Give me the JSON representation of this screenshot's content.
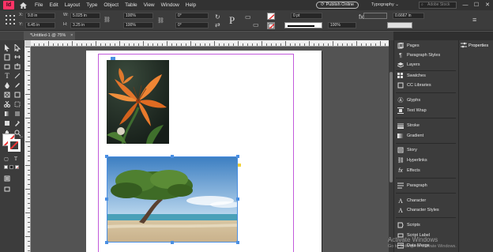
{
  "app": {
    "logo": "Id"
  },
  "menu": [
    "File",
    "Edit",
    "Layout",
    "Type",
    "Object",
    "Table",
    "View",
    "Window",
    "Help"
  ],
  "header": {
    "publish_label": "Publish Online",
    "workspace_label": "Typography",
    "search_placeholder": "Adobe Stock"
  },
  "window_controls": {
    "minimize": "—",
    "maximize": "☐",
    "close": "✕"
  },
  "control_panel": {
    "x_label": "X:",
    "x_value": "9.8 in",
    "y_label": "Y:",
    "y_value": "6.45 in",
    "w_label": "W:",
    "w_value": "5.025 in",
    "h_label": "H:",
    "h_value": "3.25 in",
    "scale_x": "100%",
    "scale_y": "100%",
    "rotate": "0°",
    "shear": "0°",
    "stroke_weight": "0 pt",
    "opacity": "100%",
    "width_value": "0.6667 in"
  },
  "document_tab": {
    "title": "*Untitled-1 @ 75%",
    "close": "×"
  },
  "panels": {
    "items": [
      {
        "label": "Pages",
        "icon": "pages-icon"
      },
      {
        "label": "Paragraph Styles",
        "icon": "paragraph-styles-icon"
      },
      {
        "label": "Layers",
        "icon": "layers-icon"
      },
      {
        "label": "Swatches",
        "icon": "swatches-icon"
      },
      {
        "label": "CC Libraries",
        "icon": "cc-libraries-icon"
      },
      {
        "label": "Glyphs",
        "icon": "glyphs-icon"
      },
      {
        "label": "Text Wrap",
        "icon": "text-wrap-icon"
      },
      {
        "label": "Stroke",
        "icon": "stroke-icon"
      },
      {
        "label": "Gradient",
        "icon": "gradient-icon"
      },
      {
        "label": "Story",
        "icon": "story-icon"
      },
      {
        "label": "Hyperlinks",
        "icon": "hyperlinks-icon"
      },
      {
        "label": "Effects",
        "icon": "effects-icon"
      },
      {
        "label": "Paragraph",
        "icon": "paragraph-icon"
      },
      {
        "label": "Character",
        "icon": "character-icon"
      },
      {
        "label": "Character Styles",
        "icon": "character-styles-icon"
      },
      {
        "label": "Scripts",
        "icon": "scripts-icon"
      },
      {
        "label": "Script Label",
        "icon": "script-label-icon"
      },
      {
        "label": "Data Merge",
        "icon": "data-merge-icon"
      }
    ]
  },
  "properties_tab": {
    "label": "Properties"
  },
  "watermark": {
    "line1": "Activate Windows",
    "line2": "Go to Settings to activate Windows."
  },
  "colors": {
    "accent": "#ff3366",
    "selection": "#4a8fe3",
    "margin": "#c25adb"
  }
}
